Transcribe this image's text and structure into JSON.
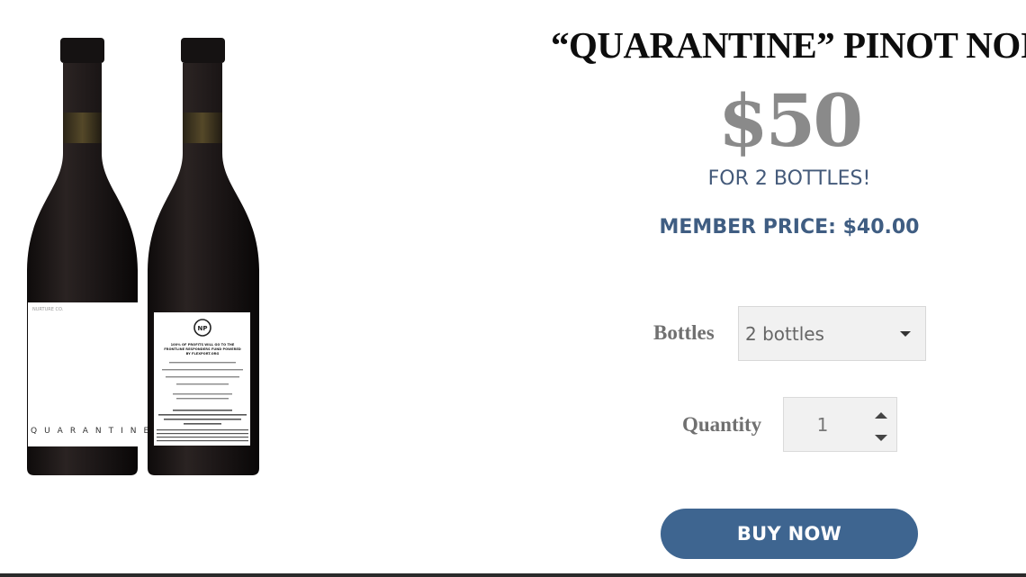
{
  "product": {
    "title": "“QUARANTINE” PINOT NOIR",
    "price": "$50",
    "price_note": "FOR 2 BOTTLES!",
    "member_price": "MEMBER PRICE: $40.00"
  },
  "bottle_labels": {
    "front_brand": "QUARANTINE",
    "front_top": "NURTURE CO.",
    "back_logo": "NP",
    "back_lines": [
      "100% OF PROFITS WILL GO TO THE",
      "FRONTLINE RESPONDERS FUND POWERED",
      "BY FLEXPORT.ORG"
    ]
  },
  "form": {
    "bottles_label": "Bottles",
    "bottles_value": "2 bottles",
    "quantity_label": "Quantity",
    "quantity_value": "1",
    "buy_label": "BUY NOW"
  },
  "colors": {
    "accent": "#3e6590",
    "member_price": "#3f5d82",
    "price_gray": "#8a8a8a",
    "bottle": "#1c1818"
  },
  "icons": {
    "select_caret": "chevron-down-icon",
    "stepper_up": "triangle-up-icon",
    "stepper_down": "triangle-down-icon"
  }
}
